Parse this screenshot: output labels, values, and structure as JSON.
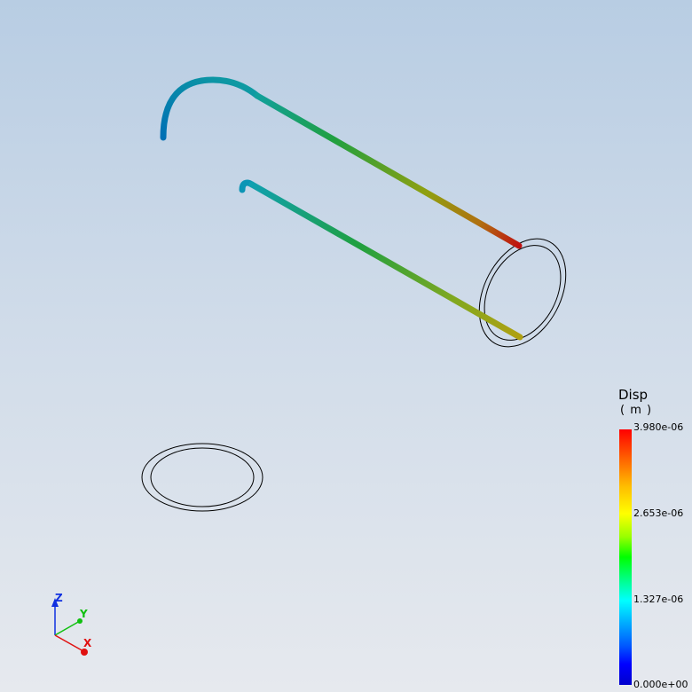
{
  "legend": {
    "title": "Disp",
    "unit": "( m )",
    "ticks": [
      "3.980e-06",
      "2.653e-06",
      "1.327e-06",
      "0.000e+00"
    ]
  },
  "triad": {
    "z_label": "Z",
    "y_label": "Y",
    "x_label": "X"
  },
  "colors": {
    "max": "#ff0000",
    "mid": "#00ff00",
    "min": "#0000ff",
    "axis_x": "#e01010",
    "axis_y": "#10c010",
    "axis_z": "#1030e0"
  }
}
